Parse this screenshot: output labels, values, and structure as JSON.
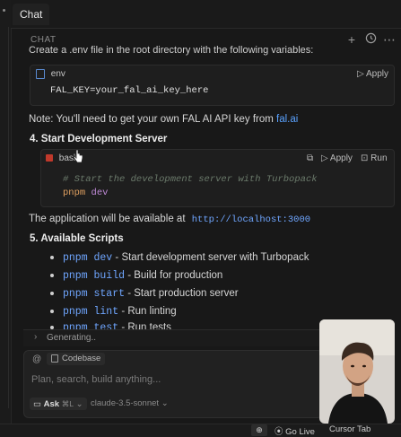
{
  "tab": {
    "label": "Chat"
  },
  "panel": {
    "title": "CHAT",
    "icons": [
      "plus-icon",
      "history-icon",
      "more-icon"
    ]
  },
  "content": {
    "cut_text": "Create a .env file in the root directory with the following variables:",
    "env_block": {
      "lang": "env",
      "apply": "Apply",
      "code": "FAL_KEY=your_fal_ai_key_here"
    },
    "note": {
      "text": "Note: You'll need to get your own FAL AI API key from ",
      "link": "fal.ai"
    },
    "step4": {
      "number": "4.",
      "title": "Start Development Server"
    },
    "bash_block": {
      "lang": "bash",
      "apply": "Apply",
      "run": "Run",
      "comment": "# Start the development server with Turbopack",
      "cmd1": "pnpm",
      "cmd2": "dev"
    },
    "availability": {
      "text": "The application will be available at",
      "url": "http://localhost:3000"
    },
    "step5": {
      "number": "5.",
      "title": "Available Scripts"
    },
    "scripts": [
      {
        "code": "pnpm dev",
        "desc": "- Start development server with Turbopack"
      },
      {
        "code": "pnpm build",
        "desc": "- Build for production"
      },
      {
        "code": "pnpm start",
        "desc": "- Start production server"
      },
      {
        "code": "pnpm lint",
        "desc": "- Run linting"
      },
      {
        "code": "pnpm test",
        "desc": "- Run tests"
      }
    ]
  },
  "generating": "Generating..",
  "composer": {
    "chip": "Codebase",
    "placeholder": "Plan, search, build anything...",
    "mode": "Ask",
    "shortcut": "⌘L",
    "model": "claude-3.5-sonnet"
  },
  "status": {
    "go_live": "Go Live",
    "cursor_tab": "Cursor Tab"
  }
}
